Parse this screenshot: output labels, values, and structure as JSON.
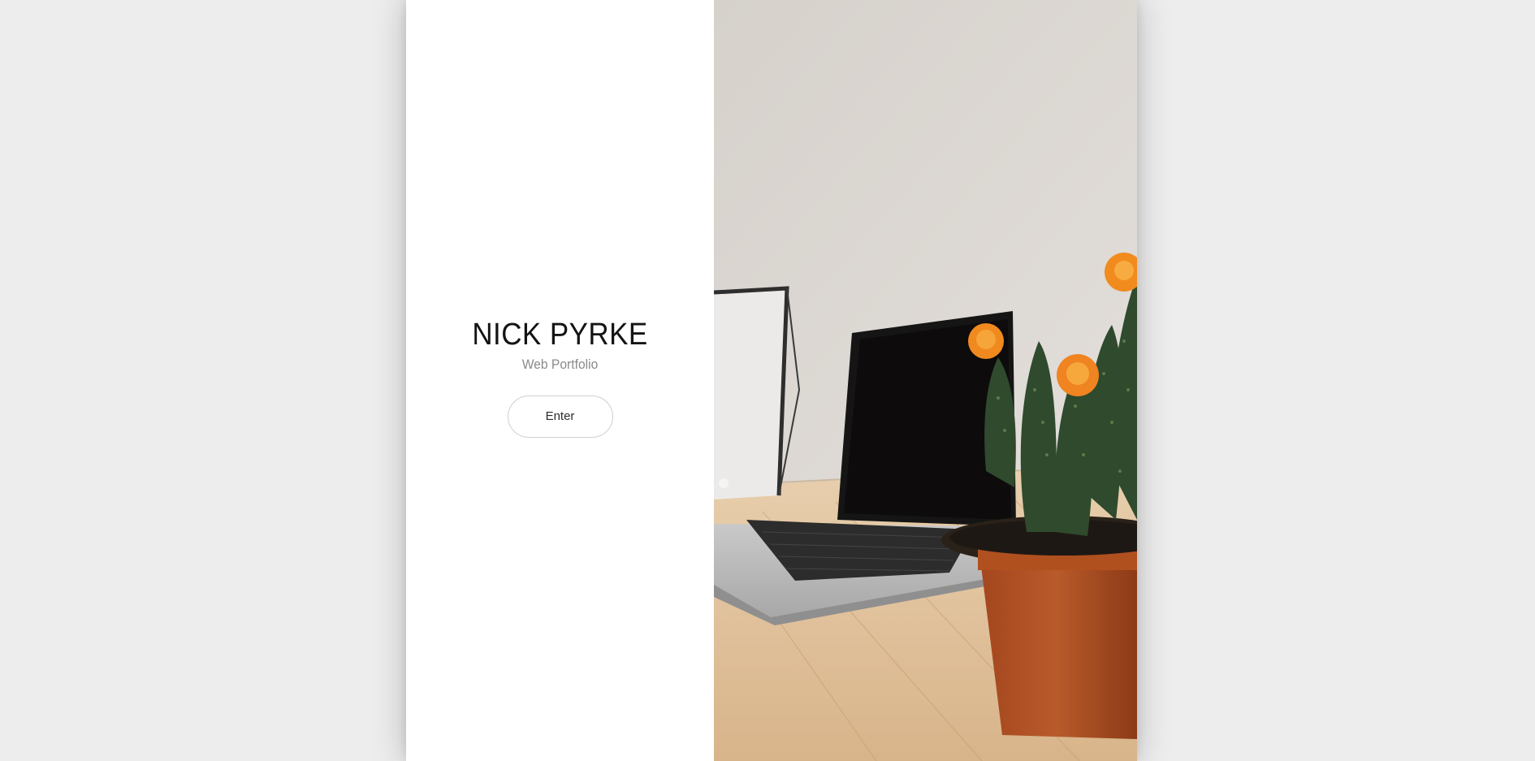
{
  "intro": {
    "title": "NICK PYRKE",
    "subtitle": "Web Portfolio",
    "enter_label": "Enter"
  },
  "hero_image": {
    "subject": "laptop, picture frame and potted cactus with orange flowers on a wooden desk"
  },
  "colors": {
    "page_background": "#ededed",
    "panel_background": "#ffffff",
    "title_text": "#141414",
    "subtitle_text": "#8a8a8a",
    "button_border": "#cfcfcf"
  },
  "icons": []
}
